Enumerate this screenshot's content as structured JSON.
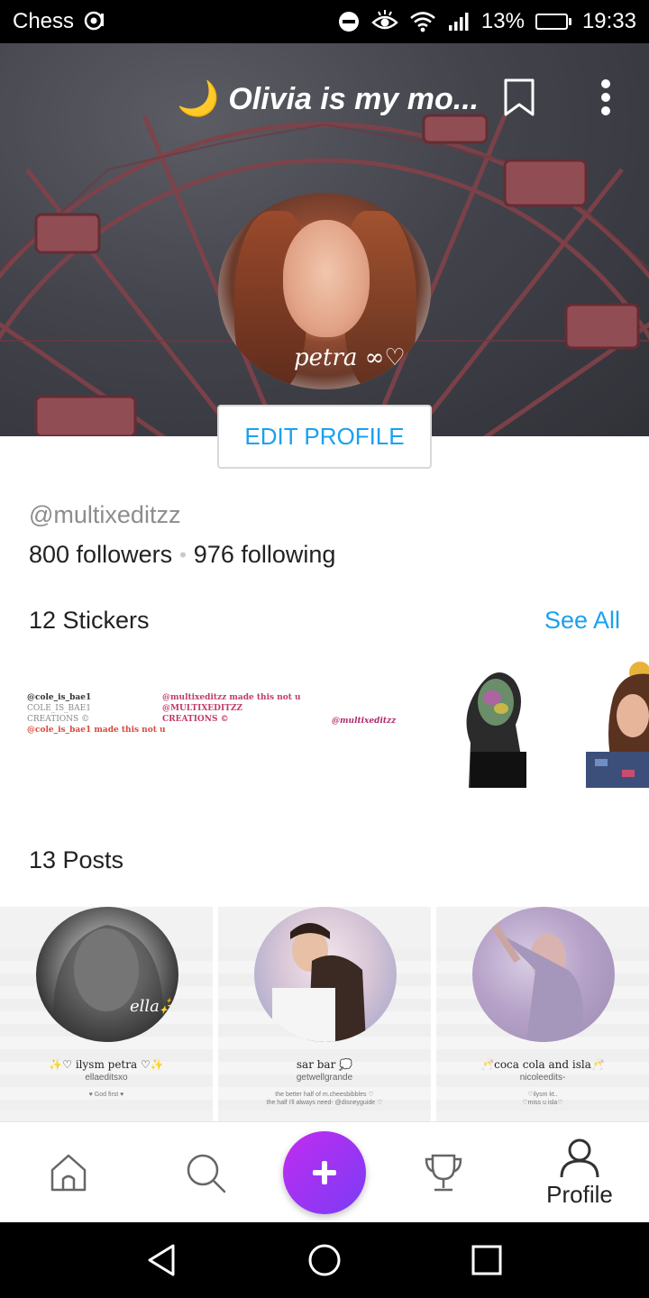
{
  "status_bar": {
    "app_name": "Chess",
    "battery": "13%",
    "battery_level": 0.13,
    "time": "19:33"
  },
  "cover": {
    "moon": "🌙",
    "title": "Olivia is my mo...",
    "signature": "petra ∞♡"
  },
  "edit_profile_label": "EDIT PROFILE",
  "profile": {
    "username": "@multixeditzz",
    "followers": "800 followers",
    "following": "976 following",
    "separator": "•"
  },
  "stickers": {
    "title": "12 Stickers",
    "see_all": "See All",
    "s1": [
      "@cole_is_bae1",
      "COLE_IS_BAE1",
      "CREATIONS ©",
      "@cole_is_bae1 made this not u"
    ],
    "s2": [
      "@multixeditzz made this not u",
      "@MULTIXEDITZZ",
      "CREATIONS ©"
    ],
    "s3": "@multixeditzz"
  },
  "posts": {
    "title": "13 Posts",
    "items": [
      {
        "overlay": "ella✨",
        "name": "✨♡ ilysm petra ♡✨",
        "sub": "ellaeditsxo",
        "tiny": "♥ God first ♥"
      },
      {
        "name": "sar bar 💭",
        "sub": "getwellgrande",
        "tiny": "the better half of m.cheesbibbles ♡\nthe half i'll always need- @disneyguide ♡"
      },
      {
        "name": "🥂coca cola and isla🥂",
        "sub": "nicoleedits-",
        "tiny": "♡ilysm kt..\n♡miss u isla♡"
      }
    ]
  },
  "nav": {
    "profile_label": "Profile"
  },
  "colors": {
    "accent": "#1aa1ef",
    "fab_start": "#c12cf0",
    "fab_end": "#7a3cf5",
    "battery": "#f5a623"
  }
}
